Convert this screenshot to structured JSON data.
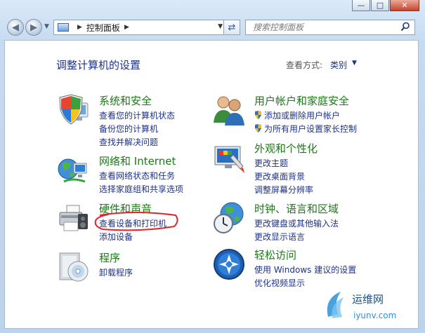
{
  "window": {
    "minimize": "—",
    "maximize": "□",
    "close": "✕"
  },
  "nav": {
    "back_icon": "back-arrow-icon",
    "forward_icon": "forward-arrow-icon"
  },
  "address": {
    "segment": "控制面板",
    "arrow": "▶",
    "dropdown": "▼"
  },
  "search": {
    "placeholder": "搜索控制面板"
  },
  "page": {
    "title": "调整计算机的设置",
    "view_by_label": "查看方式:",
    "view_by_value": "类别"
  },
  "categories": [
    {
      "heading": "系统和安全",
      "icon": "shield-pc-icon",
      "links": [
        "查看您的计算机状态",
        "备份您的计算机",
        "查找并解决问题"
      ]
    },
    {
      "heading": "网络和 Internet",
      "icon": "globe-network-icon",
      "links": [
        "查看网络状态和任务",
        "选择家庭组和共享选项"
      ]
    },
    {
      "heading": "硬件和声音",
      "icon": "printer-icon",
      "links": [
        "查看设备和打印机",
        "添加设备"
      ]
    },
    {
      "heading": "程序",
      "icon": "programs-disc-icon",
      "links": [
        "卸载程序"
      ]
    },
    {
      "heading": "用户帐户和家庭安全",
      "icon": "users-icon",
      "links": [
        "添加或删除用户帐户",
        "为所有用户设置家长控制"
      ]
    },
    {
      "heading": "外观和个性化",
      "icon": "display-icon",
      "links": [
        "更改主题",
        "更改桌面背景",
        "调整屏幕分辨率"
      ]
    },
    {
      "heading": "时钟、语言和区域",
      "icon": "clock-globe-icon",
      "links": [
        "更改键盘或其他输入法",
        "更改显示语言"
      ]
    },
    {
      "heading": "轻松访问",
      "icon": "ease-of-access-icon",
      "links": [
        "使用 Windows 建议的设置",
        "优化视频显示"
      ]
    }
  ],
  "watermark": {
    "text": "运维网",
    "url": "iyunv.com"
  },
  "colors": {
    "link": "#1e3287",
    "heading": "#1a7a16",
    "annotation": "#e0262a"
  }
}
